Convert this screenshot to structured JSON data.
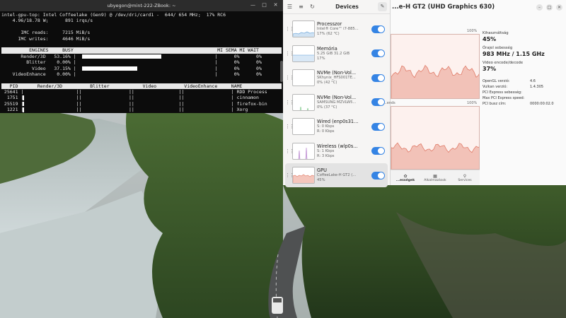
{
  "terminal": {
    "title": "ubyegon@mint-222-ZBook: ~",
    "header_line": "intel-gpu-top: Intel Coffeelake (Gen9) @ /dev/dri/card1 -  644/ 654 MHz;  17% RC6",
    "power_line": "    4.96/18.78 W;      891 irqs/s",
    "imc_reads": "       IMC reads:     7215 MiB/s",
    "imc_writes": "      IMC writes:     4646 MiB/s",
    "engines_header": "          ENGINES     BUSY                                                    MI SEMA MI WAIT",
    "engines": [
      {
        "text": "       Render/3D   53.16% |                                                  |      0%      0%",
        "busy": 53.16
      },
      {
        "text": "         Blitter    0.00% |                                                  |      0%      0%",
        "busy": 0.0
      },
      {
        "text": "           Video   37.15% |                                                  |      0%      0%",
        "busy": 37.15
      },
      {
        "text": "    VideoEnhance    0.00% |                                                  |      0%      0%",
        "busy": 0.0
      }
    ],
    "clients_header": "   PID       Render/3D          Blitter            Video          VideoEnhance     NAME",
    "clients": [
      {
        "text": " 25641 |                   ||                 ||                ||                 | RDD Process",
        "render": 0.0
      },
      {
        "text": "  1751 |                   ||                 ||                ||                 | cinnamon",
        "render": 0.2
      },
      {
        "text": " 25519 |                   ||                 ||                ||                 | firefox-bin",
        "render": 0.18
      },
      {
        "text": "  1221 |                   ||                 ||                ||                 | Xorg",
        "render": 0.1
      }
    ]
  },
  "resources": {
    "title": "Devices",
    "devices": [
      {
        "name": "Processzor",
        "line1": "Intel® Core™ i7-885...",
        "line2": "17% (62 °C)",
        "graph": "cpu"
      },
      {
        "name": "Memória",
        "line1": "5.25 GiB 31.2 GiB",
        "line2": "17%",
        "graph": "mem"
      },
      {
        "name": "NVMe (Non-Vol...",
        "line1": "SKhynix_HFS001TE...",
        "line2": "0% (42 °C)",
        "graph": "disk1"
      },
      {
        "name": "NVMe (Non-Vol...",
        "line1": "SAMSUNG MZVLW5...",
        "line2": "0% (37 °C)",
        "graph": "disk2"
      },
      {
        "name": "Wired (enp0s31...",
        "line1": "S: 0 Kbps",
        "line2": "R: 0 Kbps",
        "graph": "wired"
      },
      {
        "name": "Wireless (wlp0s...",
        "line1": "S: 1 Kbps",
        "line2": "R: 3 Kbps",
        "graph": "wifi"
      },
      {
        "name": "GPU",
        "line1": "CoffeeLake-H GT2 (...",
        "line2": "45%",
        "graph": "gpu",
        "selected": true
      }
    ]
  },
  "gpu": {
    "title": "...e-H GT2 (UHD Graphics 630)",
    "graph1_max": "100%",
    "graph2_label": "...ends",
    "graph2_max": "100%",
    "usage_label": "Kihasználtság",
    "usage_value": "45%",
    "clock_label": "Órajel sebesség",
    "clock_value": "983 MHz / 1.15 GHz",
    "video_label": "Video encode/decode",
    "video_value": "37%",
    "props": [
      {
        "k": "OpenGL verzió:",
        "v": "4.6"
      },
      {
        "k": "Vulkan verzió:",
        "v": "1.4.305"
      },
      {
        "k": "PCI Express sebesség:",
        "v": ""
      },
      {
        "k": "Max PCI Express speed:",
        "v": ""
      },
      {
        "k": "PCI busz cím:",
        "v": "0000:00:02.0"
      }
    ],
    "tabs": [
      {
        "icon": "✿",
        "label": "...ességek"
      },
      {
        "icon": "▦",
        "label": "Alkalmazások"
      },
      {
        "icon": "⚲",
        "label": "Services"
      }
    ]
  }
}
